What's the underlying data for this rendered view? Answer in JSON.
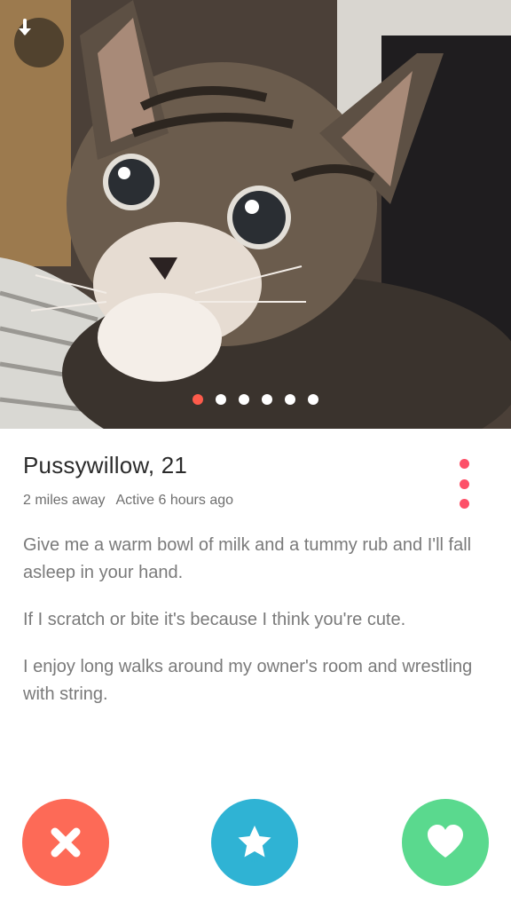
{
  "profile": {
    "name_age": "Pussywillow, 21",
    "distance": "2 miles away",
    "active": "Active 6 hours ago",
    "bio": [
      "Give me a warm bowl of milk and a tummy rub and I'll fall asleep in your hand.",
      "If I scratch or bite it's because I think you're cute.",
      "I enjoy long walks around my owner's room and wrestling with string."
    ]
  },
  "photo": {
    "subject": "tabby kitten",
    "page_count": 6,
    "current_page": 1
  },
  "icons": {
    "back": "arrow-down-icon",
    "more": "more-vertical-icon",
    "nope": "close-icon",
    "super_like": "star-icon",
    "like": "heart-icon"
  },
  "colors": {
    "accent": "#fd5b4b",
    "nope": "#fd6a57",
    "super_like": "#2fb3d4",
    "like": "#5ad98e",
    "menu_dots": "#fd5068"
  }
}
